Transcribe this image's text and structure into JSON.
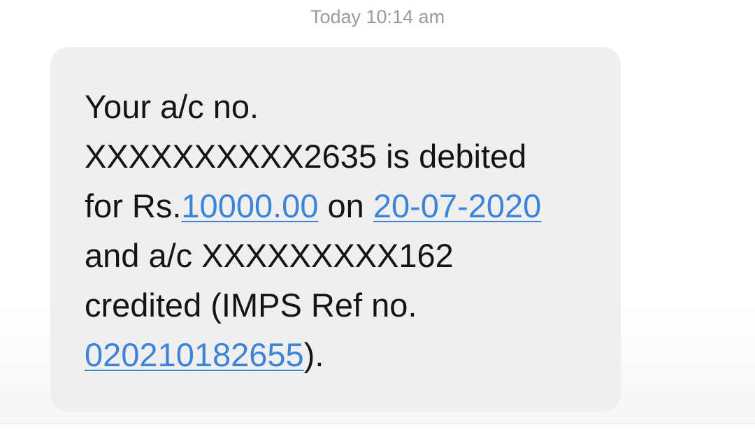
{
  "timestamp": "Today 10:14 am",
  "message": {
    "line1": "Your a/c no.",
    "line2": "XXXXXXXXXX2635 is debited",
    "line3_prefix": "for Rs.",
    "line3_amount": "10000.00",
    "line3_mid": " on ",
    "line3_date": "20-07-2020",
    "line4": "and a/c XXXXXXXXX162",
    "line5": "credited (IMPS Ref no.",
    "line6_ref": "020210182655",
    "line6_suffix": ")."
  },
  "colors": {
    "bubble": "#efefef",
    "link": "#3d84d9",
    "text": "#141414",
    "timestamp": "#9a9a9a"
  }
}
